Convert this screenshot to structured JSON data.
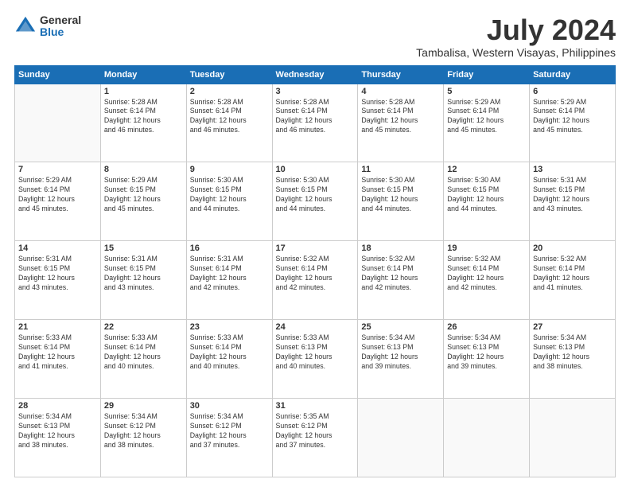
{
  "logo": {
    "general": "General",
    "blue": "Blue"
  },
  "title": "July 2024",
  "subtitle": "Tambalisa, Western Visayas, Philippines",
  "days": [
    "Sunday",
    "Monday",
    "Tuesday",
    "Wednesday",
    "Thursday",
    "Friday",
    "Saturday"
  ],
  "weeks": [
    [
      {
        "day": "",
        "info": ""
      },
      {
        "day": "1",
        "info": "Sunrise: 5:28 AM\nSunset: 6:14 PM\nDaylight: 12 hours\nand 46 minutes."
      },
      {
        "day": "2",
        "info": "Sunrise: 5:28 AM\nSunset: 6:14 PM\nDaylight: 12 hours\nand 46 minutes."
      },
      {
        "day": "3",
        "info": "Sunrise: 5:28 AM\nSunset: 6:14 PM\nDaylight: 12 hours\nand 46 minutes."
      },
      {
        "day": "4",
        "info": "Sunrise: 5:28 AM\nSunset: 6:14 PM\nDaylight: 12 hours\nand 45 minutes."
      },
      {
        "day": "5",
        "info": "Sunrise: 5:29 AM\nSunset: 6:14 PM\nDaylight: 12 hours\nand 45 minutes."
      },
      {
        "day": "6",
        "info": "Sunrise: 5:29 AM\nSunset: 6:14 PM\nDaylight: 12 hours\nand 45 minutes."
      }
    ],
    [
      {
        "day": "7",
        "info": "Sunrise: 5:29 AM\nSunset: 6:14 PM\nDaylight: 12 hours\nand 45 minutes."
      },
      {
        "day": "8",
        "info": "Sunrise: 5:29 AM\nSunset: 6:15 PM\nDaylight: 12 hours\nand 45 minutes."
      },
      {
        "day": "9",
        "info": "Sunrise: 5:30 AM\nSunset: 6:15 PM\nDaylight: 12 hours\nand 44 minutes."
      },
      {
        "day": "10",
        "info": "Sunrise: 5:30 AM\nSunset: 6:15 PM\nDaylight: 12 hours\nand 44 minutes."
      },
      {
        "day": "11",
        "info": "Sunrise: 5:30 AM\nSunset: 6:15 PM\nDaylight: 12 hours\nand 44 minutes."
      },
      {
        "day": "12",
        "info": "Sunrise: 5:30 AM\nSunset: 6:15 PM\nDaylight: 12 hours\nand 44 minutes."
      },
      {
        "day": "13",
        "info": "Sunrise: 5:31 AM\nSunset: 6:15 PM\nDaylight: 12 hours\nand 43 minutes."
      }
    ],
    [
      {
        "day": "14",
        "info": "Sunrise: 5:31 AM\nSunset: 6:15 PM\nDaylight: 12 hours\nand 43 minutes."
      },
      {
        "day": "15",
        "info": "Sunrise: 5:31 AM\nSunset: 6:15 PM\nDaylight: 12 hours\nand 43 minutes."
      },
      {
        "day": "16",
        "info": "Sunrise: 5:31 AM\nSunset: 6:14 PM\nDaylight: 12 hours\nand 42 minutes."
      },
      {
        "day": "17",
        "info": "Sunrise: 5:32 AM\nSunset: 6:14 PM\nDaylight: 12 hours\nand 42 minutes."
      },
      {
        "day": "18",
        "info": "Sunrise: 5:32 AM\nSunset: 6:14 PM\nDaylight: 12 hours\nand 42 minutes."
      },
      {
        "day": "19",
        "info": "Sunrise: 5:32 AM\nSunset: 6:14 PM\nDaylight: 12 hours\nand 42 minutes."
      },
      {
        "day": "20",
        "info": "Sunrise: 5:32 AM\nSunset: 6:14 PM\nDaylight: 12 hours\nand 41 minutes."
      }
    ],
    [
      {
        "day": "21",
        "info": "Sunrise: 5:33 AM\nSunset: 6:14 PM\nDaylight: 12 hours\nand 41 minutes."
      },
      {
        "day": "22",
        "info": "Sunrise: 5:33 AM\nSunset: 6:14 PM\nDaylight: 12 hours\nand 40 minutes."
      },
      {
        "day": "23",
        "info": "Sunrise: 5:33 AM\nSunset: 6:14 PM\nDaylight: 12 hours\nand 40 minutes."
      },
      {
        "day": "24",
        "info": "Sunrise: 5:33 AM\nSunset: 6:13 PM\nDaylight: 12 hours\nand 40 minutes."
      },
      {
        "day": "25",
        "info": "Sunrise: 5:34 AM\nSunset: 6:13 PM\nDaylight: 12 hours\nand 39 minutes."
      },
      {
        "day": "26",
        "info": "Sunrise: 5:34 AM\nSunset: 6:13 PM\nDaylight: 12 hours\nand 39 minutes."
      },
      {
        "day": "27",
        "info": "Sunrise: 5:34 AM\nSunset: 6:13 PM\nDaylight: 12 hours\nand 38 minutes."
      }
    ],
    [
      {
        "day": "28",
        "info": "Sunrise: 5:34 AM\nSunset: 6:13 PM\nDaylight: 12 hours\nand 38 minutes."
      },
      {
        "day": "29",
        "info": "Sunrise: 5:34 AM\nSunset: 6:12 PM\nDaylight: 12 hours\nand 38 minutes."
      },
      {
        "day": "30",
        "info": "Sunrise: 5:34 AM\nSunset: 6:12 PM\nDaylight: 12 hours\nand 37 minutes."
      },
      {
        "day": "31",
        "info": "Sunrise: 5:35 AM\nSunset: 6:12 PM\nDaylight: 12 hours\nand 37 minutes."
      },
      {
        "day": "",
        "info": ""
      },
      {
        "day": "",
        "info": ""
      },
      {
        "day": "",
        "info": ""
      }
    ]
  ]
}
